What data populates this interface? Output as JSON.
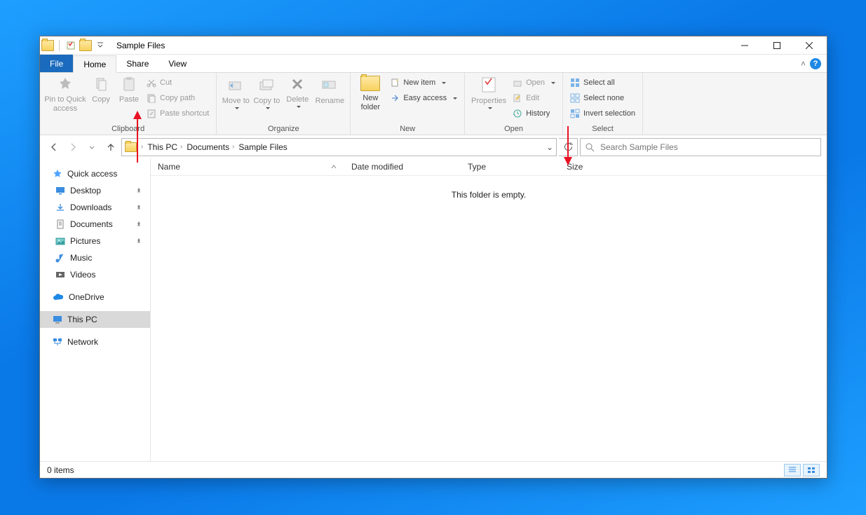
{
  "titlebar": {
    "title": "Sample Files"
  },
  "tabs": {
    "file": "File",
    "home": "Home",
    "share": "Share",
    "view": "View"
  },
  "ribbon": {
    "clipboard": {
      "label": "Clipboard",
      "pin": "Pin to Quick access",
      "copy": "Copy",
      "paste": "Paste",
      "cut": "Cut",
      "copypath": "Copy path",
      "pastesc": "Paste shortcut"
    },
    "organize": {
      "label": "Organize",
      "moveto": "Move to",
      "copyto": "Copy to",
      "delete": "Delete",
      "rename": "Rename"
    },
    "new": {
      "label": "New",
      "newfolder": "New folder",
      "newitem": "New item",
      "easyaccess": "Easy access"
    },
    "open": {
      "label": "Open",
      "properties": "Properties",
      "open": "Open",
      "edit": "Edit",
      "history": "History"
    },
    "select": {
      "label": "Select",
      "all": "Select all",
      "none": "Select none",
      "invert": "Invert selection"
    }
  },
  "breadcrumb": {
    "pc": "This PC",
    "docs": "Documents",
    "folder": "Sample Files"
  },
  "search": {
    "placeholder": "Search Sample Files"
  },
  "columns": {
    "name": "Name",
    "date": "Date modified",
    "type": "Type",
    "size": "Size"
  },
  "content": {
    "empty": "This folder is empty."
  },
  "nav": {
    "quick": "Quick access",
    "desktop": "Desktop",
    "downloads": "Downloads",
    "documents": "Documents",
    "pictures": "Pictures",
    "music": "Music",
    "videos": "Videos",
    "onedrive": "OneDrive",
    "thispc": "This PC",
    "network": "Network"
  },
  "status": {
    "count": "0 items"
  }
}
